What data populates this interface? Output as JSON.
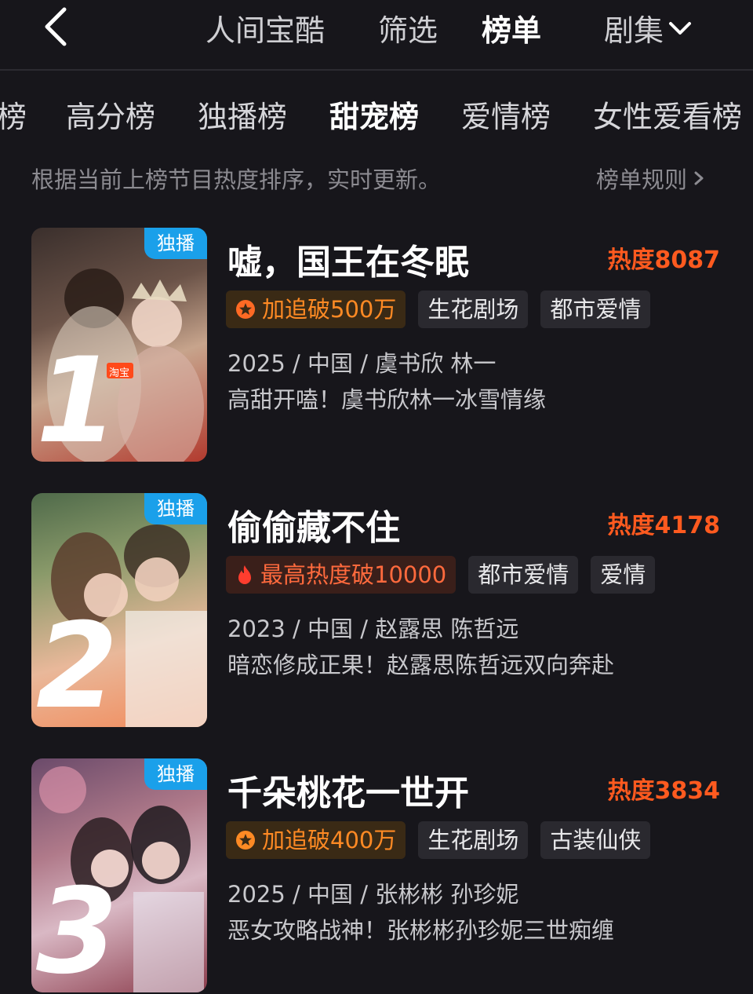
{
  "header": {
    "nav": [
      "人间宝酷",
      "筛选",
      "榜单",
      "剧集"
    ],
    "active_index": 2
  },
  "tabs": {
    "items": [
      "榜",
      "高分榜",
      "独播榜",
      "甜宠榜",
      "爱情榜",
      "女性爱看榜"
    ],
    "active_index": 3
  },
  "info": {
    "description": "根据当前上榜节目热度排序，实时更新。",
    "rules_label": "榜单规则"
  },
  "colors": {
    "background": "#17161b",
    "heat": "#ff5a1f",
    "badge": "#1aa0ea"
  },
  "list": [
    {
      "rank": "1",
      "badge": "独播",
      "title": "嘘，国王在冬眠",
      "heat": "热度8087",
      "tags": [
        {
          "icon": "star-icon",
          "label": "加追破500万"
        },
        {
          "label": "生花剧场"
        },
        {
          "label": "都市爱情"
        }
      ],
      "meta": "2025 / 中国 / 虞书欣 林一",
      "blurb": "高甜开嗑！虞书欣林一冰雪情缘",
      "poster_text": "淘宝"
    },
    {
      "rank": "2",
      "badge": "独播",
      "title": "偷偷藏不住",
      "heat": "热度4178",
      "tags": [
        {
          "icon": "flame-icon",
          "label": "最高热度破10000"
        },
        {
          "label": "都市爱情"
        },
        {
          "label": "爱情"
        }
      ],
      "meta": "2023 / 中国 / 赵露思 陈哲远",
      "blurb": "暗恋修成正果！赵露思陈哲远双向奔赴"
    },
    {
      "rank": "3",
      "badge": "独播",
      "title": "千朵桃花一世开",
      "heat": "热度3834",
      "tags": [
        {
          "icon": "star-icon",
          "label": "加追破400万"
        },
        {
          "label": "生花剧场"
        },
        {
          "label": "古装仙侠"
        }
      ],
      "meta": "2025 / 中国 / 张彬彬 孙珍妮",
      "blurb": "恶女攻略战神！张彬彬孙珍妮三世痴缠"
    }
  ]
}
